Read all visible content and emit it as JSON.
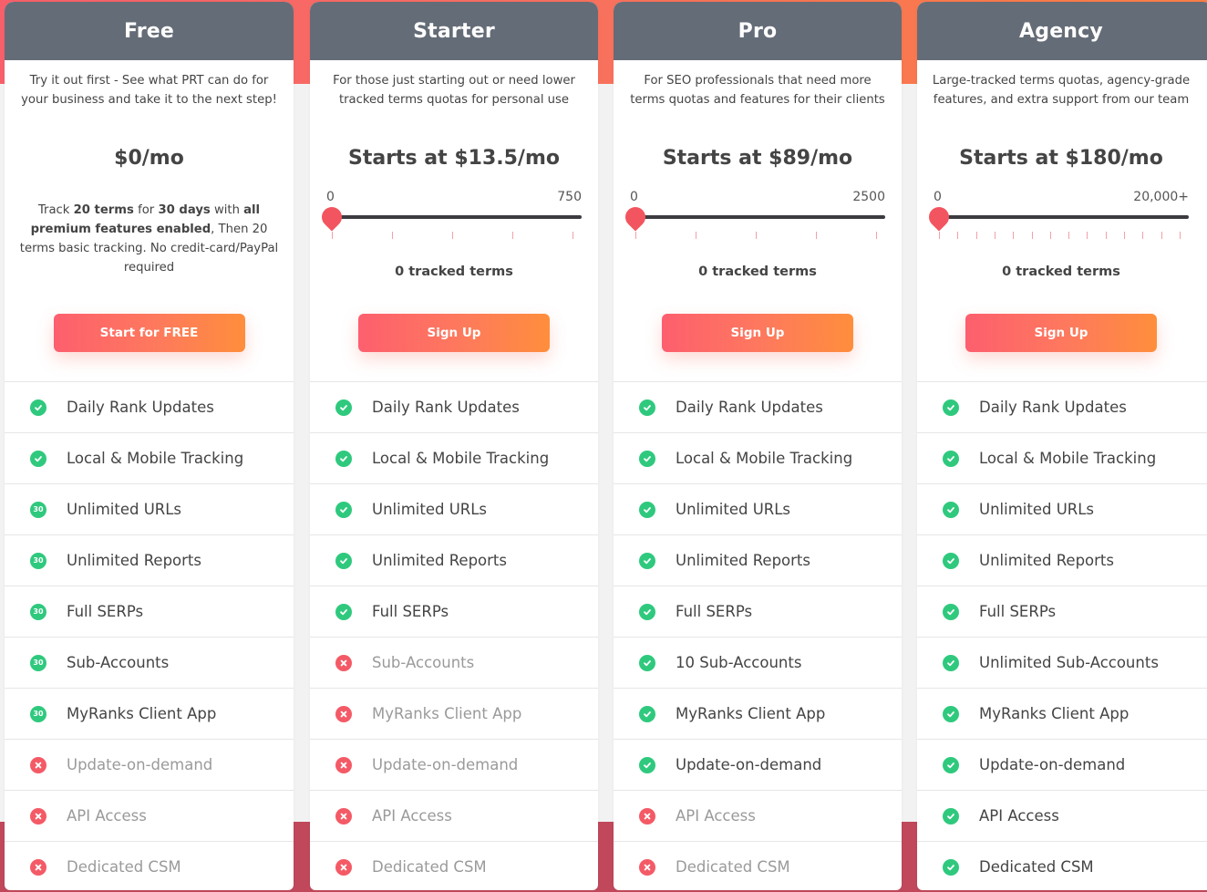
{
  "colors": {
    "header_bg": "#646c77",
    "check_green": "#2fc97e",
    "cross_red": "#f45a66",
    "slider_handle": "#f2555f",
    "cta_gradient_start": "#fd5f6e",
    "cta_gradient_end": "#ff8e3c",
    "bg_top_start": "#f7606a",
    "bg_top_end": "#fb7f48",
    "bg_bottom": "#c0485a"
  },
  "plans": [
    {
      "name": "Free",
      "description": "Try it out first - See what PRT can do for your business and take it to the next step!",
      "price": "$0/mo",
      "note": {
        "parts": [
          {
            "text": "Track ",
            "bold": false
          },
          {
            "text": "20 terms",
            "bold": true
          },
          {
            "text": " for ",
            "bold": false
          },
          {
            "text": "30 days",
            "bold": true
          },
          {
            "text": " with ",
            "bold": false
          },
          {
            "text": "all premium features enabled",
            "bold": true
          },
          {
            "text": ", Then 20 terms basic tracking. No credit-card/PayPal required",
            "bold": false
          }
        ]
      },
      "cta": "Start for FREE",
      "features": [
        {
          "label": "Daily Rank Updates",
          "status": "check"
        },
        {
          "label": "Local & Mobile Tracking",
          "status": "check"
        },
        {
          "label": "Unlimited URLs",
          "status": "trial",
          "badge": "30"
        },
        {
          "label": "Unlimited Reports",
          "status": "trial",
          "badge": "30"
        },
        {
          "label": "Full SERPs",
          "status": "trial",
          "badge": "30"
        },
        {
          "label": "Sub-Accounts",
          "status": "trial",
          "badge": "30"
        },
        {
          "label": "MyRanks Client App",
          "status": "trial",
          "badge": "30"
        },
        {
          "label": "Update-on-demand",
          "status": "cross"
        },
        {
          "label": "API Access",
          "status": "cross"
        },
        {
          "label": "Dedicated CSM",
          "status": "cross"
        }
      ]
    },
    {
      "name": "Starter",
      "description": "For those just starting out or need lower tracked terms quotas for personal use",
      "price": "Starts at $13.5/mo",
      "slider": {
        "min_label": "0",
        "max_label": "750",
        "value": 0,
        "ticks": 5
      },
      "tracked": "0 tracked terms",
      "cta": "Sign Up",
      "features": [
        {
          "label": "Daily Rank Updates",
          "status": "check"
        },
        {
          "label": "Local & Mobile Tracking",
          "status": "check"
        },
        {
          "label": "Unlimited URLs",
          "status": "check"
        },
        {
          "label": "Unlimited Reports",
          "status": "check"
        },
        {
          "label": "Full SERPs",
          "status": "check"
        },
        {
          "label": "Sub-Accounts",
          "status": "cross"
        },
        {
          "label": "MyRanks Client App",
          "status": "cross"
        },
        {
          "label": "Update-on-demand",
          "status": "cross"
        },
        {
          "label": "API Access",
          "status": "cross"
        },
        {
          "label": "Dedicated CSM",
          "status": "cross"
        }
      ]
    },
    {
      "name": "Pro",
      "description": "For SEO professionals that need more terms quotas and features for their clients",
      "price": "Starts at $89/mo",
      "slider": {
        "min_label": "0",
        "max_label": "2500",
        "value": 0,
        "ticks": 5
      },
      "tracked": "0 tracked terms",
      "cta": "Sign Up",
      "features": [
        {
          "label": "Daily Rank Updates",
          "status": "check"
        },
        {
          "label": "Local & Mobile Tracking",
          "status": "check"
        },
        {
          "label": "Unlimited URLs",
          "status": "check"
        },
        {
          "label": "Unlimited Reports",
          "status": "check"
        },
        {
          "label": "Full SERPs",
          "status": "check"
        },
        {
          "label": "10 Sub-Accounts",
          "status": "check"
        },
        {
          "label": "MyRanks Client App",
          "status": "check"
        },
        {
          "label": "Update-on-demand",
          "status": "check"
        },
        {
          "label": "API Access",
          "status": "cross"
        },
        {
          "label": "Dedicated CSM",
          "status": "cross"
        }
      ]
    },
    {
      "name": "Agency",
      "description": "Large-tracked terms quotas, agency-grade features, and extra support from our team",
      "price": "Starts at $180/mo",
      "slider": {
        "min_label": "0",
        "max_label": "20,000+",
        "value": 0,
        "ticks": 14
      },
      "tracked": "0 tracked terms",
      "cta": "Sign Up",
      "features": [
        {
          "label": "Daily Rank Updates",
          "status": "check"
        },
        {
          "label": "Local & Mobile Tracking",
          "status": "check"
        },
        {
          "label": "Unlimited URLs",
          "status": "check"
        },
        {
          "label": "Unlimited Reports",
          "status": "check"
        },
        {
          "label": "Full SERPs",
          "status": "check"
        },
        {
          "label": "Unlimited Sub-Accounts",
          "status": "check"
        },
        {
          "label": "MyRanks Client App",
          "status": "check"
        },
        {
          "label": "Update-on-demand",
          "status": "check"
        },
        {
          "label": "API Access",
          "status": "check"
        },
        {
          "label": "Dedicated CSM",
          "status": "check"
        }
      ]
    }
  ]
}
